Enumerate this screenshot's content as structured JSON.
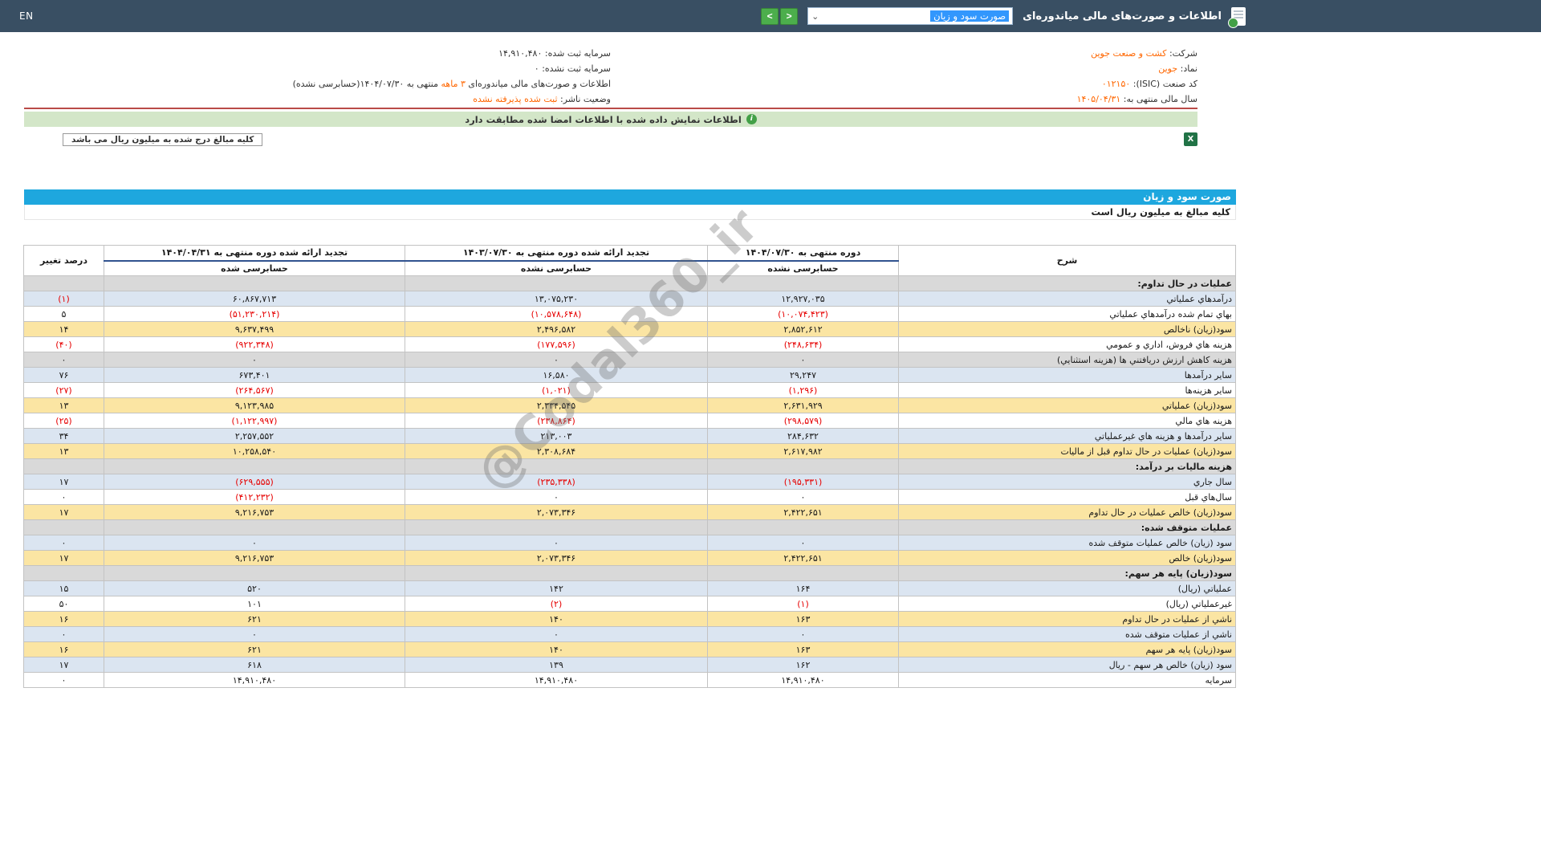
{
  "colors": {
    "topbar_navy": "#394f63",
    "accent_orange": "#ff6600",
    "divider_red": "#b94a48",
    "banner_green": "#d3e6c8",
    "bar_blue": "#1ea7de",
    "row_blue": "#dbe5f1",
    "row_yellow": "#fbe5a3",
    "row_gray": "#d9d9d9",
    "negative_red": "#e60000",
    "nav_green": "#4cae4c"
  },
  "icons": {
    "dropdown_arrow": "⌄",
    "excel": "X",
    "info": "i"
  },
  "topbar": {
    "title": "اطلاعات و صورت‌های مالی میاندوره‌ای",
    "report_selected": "صورت سود و زیان",
    "nav_right": ">",
    "nav_left": "<",
    "lang_toggle": "EN"
  },
  "company_info": {
    "rows": [
      {
        "right": [
          {
            "t": "شرکت:  "
          },
          {
            "t": "کشت و صنعت جوین",
            "o": true
          }
        ],
        "left": [
          {
            "t": "سرمایه ثبت شده:  "
          },
          {
            "t": "۱۴,۹۱۰,۴۸۰"
          }
        ]
      },
      {
        "right": [
          {
            "t": "نماد:  "
          },
          {
            "t": "جوین",
            "o": true
          }
        ],
        "left": [
          {
            "t": "سرمایه ثبت نشده:  "
          },
          {
            "t": "۰"
          }
        ]
      },
      {
        "right": [
          {
            "t": "کد صنعت (ISIC):  "
          },
          {
            "t": "۰۱۲۱۵۰",
            "o": true
          }
        ],
        "left": [
          {
            "t": "اطلاعات و صورت‌های مالی میاندوره‌ای "
          },
          {
            "t": "۳ ماهه",
            "o": true
          },
          {
            "t": " منتهی به ۱۴۰۴/۰۷/۳۰(حسابرسی نشده)"
          }
        ]
      },
      {
        "right": [
          {
            "t": "سال مالی منتهی به:  "
          },
          {
            "t": "۱۴۰۵/۰۴/۳۱",
            "o": true
          }
        ],
        "left": [
          {
            "t": "وضعیت ناشر:  "
          },
          {
            "t": "ثبت شده پذیرفته نشده",
            "o": true
          }
        ]
      }
    ]
  },
  "signature_banner": {
    "text": "اطلاعات نمایش داده شده با اطلاعات امضا شده مطابقت دارد"
  },
  "unit_note_top": "کلیه مبالغ درج شده به میلیون ریال می باشد",
  "section_bar_title": "صورت سود و زیان",
  "unit_note_table": "کلیه مبالغ به میلیون ریال است",
  "statement": {
    "headers": {
      "desc": "شرح",
      "p1_title": "دوره منتهی به ۱۴۰۴/۰۷/۳۰",
      "p1_sub": "حسابرسی نشده",
      "p2_title": "تجدید ارائه شده دوره منتهی به ۱۴۰۳/۰۷/۳۰",
      "p2_sub": "حسابرسی نشده",
      "p3_title": "تجدید ارائه شده دوره منتهی به ۱۴۰۴/۰۴/۳۱",
      "p3_sub": "حسابرسی شده",
      "chg": "درصد تغییر"
    },
    "rows": [
      {
        "label": "عملیات در حال تداوم:",
        "type": "section",
        "v1": "",
        "v2": "",
        "v3": "",
        "chg": ""
      },
      {
        "label": "درآمدهاي عملياتي",
        "type": "blue",
        "v1": "۱۲,۹۲۷,۰۳۵",
        "v2": "۱۳,۰۷۵,۲۳۰",
        "v3": "۶۰,۸۶۷,۷۱۳",
        "chg": "(۱)"
      },
      {
        "label": "بهاي تمام شده درآمدهاي عملياتي",
        "type": "white",
        "v1": "(۱۰,۰۷۴,۴۲۳)",
        "v2": "(۱۰,۵۷۸,۶۴۸)",
        "v3": "(۵۱,۲۳۰,۲۱۴)",
        "chg": "۵"
      },
      {
        "label": "سود(زيان) ناخالص",
        "type": "yellow",
        "v1": "۲,۸۵۲,۶۱۲",
        "v2": "۲,۴۹۶,۵۸۲",
        "v3": "۹,۶۳۷,۴۹۹",
        "chg": "۱۴"
      },
      {
        "label": "هزينه هاي فروش، اداري و عمومي",
        "type": "white",
        "v1": "(۲۴۸,۶۳۴)",
        "v2": "(۱۷۷,۵۹۶)",
        "v3": "(۹۲۲,۳۴۸)",
        "chg": "(۴۰)"
      },
      {
        "label": "هزينه کاهش ارزش دريافتني ها (هزينه استثنايي)",
        "type": "gray",
        "v1": "۰",
        "v2": "۰",
        "v3": "۰",
        "chg": "۰"
      },
      {
        "label": "ساير درآمدها",
        "type": "blue",
        "v1": "۲۹,۲۴۷",
        "v2": "۱۶,۵۸۰",
        "v3": "۶۷۳,۴۰۱",
        "chg": "۷۶"
      },
      {
        "label": "ساير هزينه‌ها",
        "type": "white",
        "v1": "(۱,۲۹۶)",
        "v2": "(۱,۰۲۱)",
        "v3": "(۲۶۴,۵۶۷)",
        "chg": "(۲۷)"
      },
      {
        "label": "سود(زيان) عملياتي",
        "type": "yellow",
        "v1": "۲,۶۳۱,۹۲۹",
        "v2": "۲,۳۳۴,۵۴۵",
        "v3": "۹,۱۲۳,۹۸۵",
        "chg": "۱۳"
      },
      {
        "label": "هزينه هاي مالي",
        "type": "white",
        "v1": "(۲۹۸,۵۷۹)",
        "v2": "(۲۳۸,۸۶۴)",
        "v3": "(۱,۱۲۲,۹۹۷)",
        "chg": "(۲۵)"
      },
      {
        "label": "ساير درآمدها و هزينه هاي غيرعملياتي",
        "type": "blue",
        "v1": "۲۸۴,۶۳۲",
        "v2": "۲۱۳,۰۰۳",
        "v3": "۲,۲۵۷,۵۵۲",
        "chg": "۳۴"
      },
      {
        "label": "سود(زيان) عمليات در حال تداوم قبل از ماليات",
        "type": "yellow",
        "v1": "۲,۶۱۷,۹۸۲",
        "v2": "۲,۳۰۸,۶۸۴",
        "v3": "۱۰,۲۵۸,۵۴۰",
        "chg": "۱۳"
      },
      {
        "label": "هزينه ماليات بر درآمد:",
        "type": "section",
        "v1": "",
        "v2": "",
        "v3": "",
        "chg": ""
      },
      {
        "label": "سال جاري",
        "type": "blue",
        "v1": "(۱۹۵,۳۳۱)",
        "v2": "(۲۳۵,۳۳۸)",
        "v3": "(۶۲۹,۵۵۵)",
        "chg": "۱۷"
      },
      {
        "label": "سال‌هاي قبل",
        "type": "white",
        "v1": "۰",
        "v2": "۰",
        "v3": "(۴۱۲,۲۳۲)",
        "chg": "۰"
      },
      {
        "label": "سود(زيان) خالص عمليات در حال تداوم",
        "type": "yellow",
        "v1": "۲,۴۲۲,۶۵۱",
        "v2": "۲,۰۷۳,۳۴۶",
        "v3": "۹,۲۱۶,۷۵۳",
        "chg": "۱۷"
      },
      {
        "label": "عمليات متوقف شده:",
        "type": "section",
        "v1": "",
        "v2": "",
        "v3": "",
        "chg": ""
      },
      {
        "label": "سود (زيان) خالص عمليات متوقف شده",
        "type": "blue",
        "v1": "۰",
        "v2": "۰",
        "v3": "۰",
        "chg": "۰"
      },
      {
        "label": "سود(زيان) خالص",
        "type": "yellow",
        "v1": "۲,۴۲۲,۶۵۱",
        "v2": "۲,۰۷۳,۳۴۶",
        "v3": "۹,۲۱۶,۷۵۳",
        "chg": "۱۷"
      },
      {
        "label": "سود(زيان) پايه هر سهم:",
        "type": "section",
        "v1": "",
        "v2": "",
        "v3": "",
        "chg": ""
      },
      {
        "label": "عملياتي (ريال)",
        "type": "blue",
        "v1": "۱۶۴",
        "v2": "۱۴۲",
        "v3": "۵۲۰",
        "chg": "۱۵"
      },
      {
        "label": "غيرعملياتي (ريال)",
        "type": "white",
        "v1": "(۱)",
        "v2": "(۲)",
        "v3": "۱۰۱",
        "chg": "۵۰"
      },
      {
        "label": "ناشي از عمليات در حال تداوم",
        "type": "yellow",
        "v1": "۱۶۳",
        "v2": "۱۴۰",
        "v3": "۶۲۱",
        "chg": "۱۶"
      },
      {
        "label": "ناشي از عمليات متوقف شده",
        "type": "blue",
        "v1": "۰",
        "v2": "۰",
        "v3": "۰",
        "chg": "۰"
      },
      {
        "label": "سود(زيان) پايه هر سهم",
        "type": "yellow",
        "v1": "۱۶۳",
        "v2": "۱۴۰",
        "v3": "۶۲۱",
        "chg": "۱۶"
      },
      {
        "label": "سود (زيان) خالص هر سهم - ريال",
        "type": "blue",
        "v1": "۱۶۲",
        "v2": "۱۳۹",
        "v3": "۶۱۸",
        "chg": "۱۷"
      },
      {
        "label": "سرمايه",
        "type": "white",
        "v1": "۱۴,۹۱۰,۴۸۰",
        "v2": "۱۴,۹۱۰,۴۸۰",
        "v3": "۱۴,۹۱۰,۴۸۰",
        "chg": "۰"
      }
    ]
  },
  "watermark": "@Codal360_ir"
}
